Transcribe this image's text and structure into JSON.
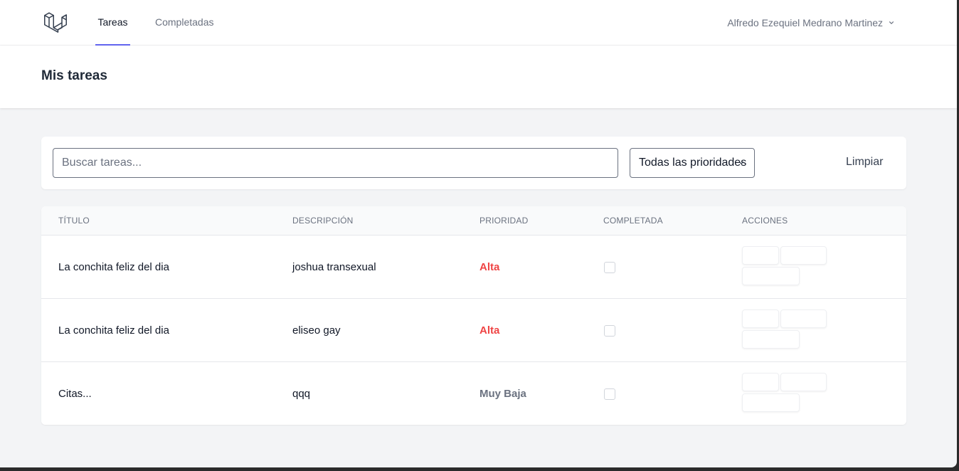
{
  "nav": {
    "logo_icon": "laravel-logo-icon",
    "links": [
      {
        "label": "Tareas",
        "active": true
      },
      {
        "label": "Completadas",
        "active": false
      }
    ],
    "user_name": "Alfredo Ezequiel Medrano Martinez",
    "user_chevron_icon": "chevron-down-icon"
  },
  "header": {
    "title": "Mis tareas"
  },
  "filters": {
    "search_placeholder": "Buscar tareas...",
    "search_value": "",
    "priority_selected": "Todas las prioridades",
    "clear_label": "Limpiar"
  },
  "table": {
    "columns": [
      "Título",
      "Descripción",
      "Prioridad",
      "Completada",
      "Acciones"
    ],
    "rows": [
      {
        "title": "La conchita feliz del dia",
        "description": "joshua transexual",
        "priority": "Alta",
        "completed": false
      },
      {
        "title": "La conchita feliz del dia",
        "description": "eliseo gay",
        "priority": "Alta",
        "completed": false
      },
      {
        "title": "Citas...",
        "description": "qqq",
        "priority": "Muy Baja",
        "completed": false
      }
    ]
  },
  "colors": {
    "accent": "#6366f1",
    "priority_high": "#ef4444",
    "priority_very_low": "#6b7280"
  }
}
